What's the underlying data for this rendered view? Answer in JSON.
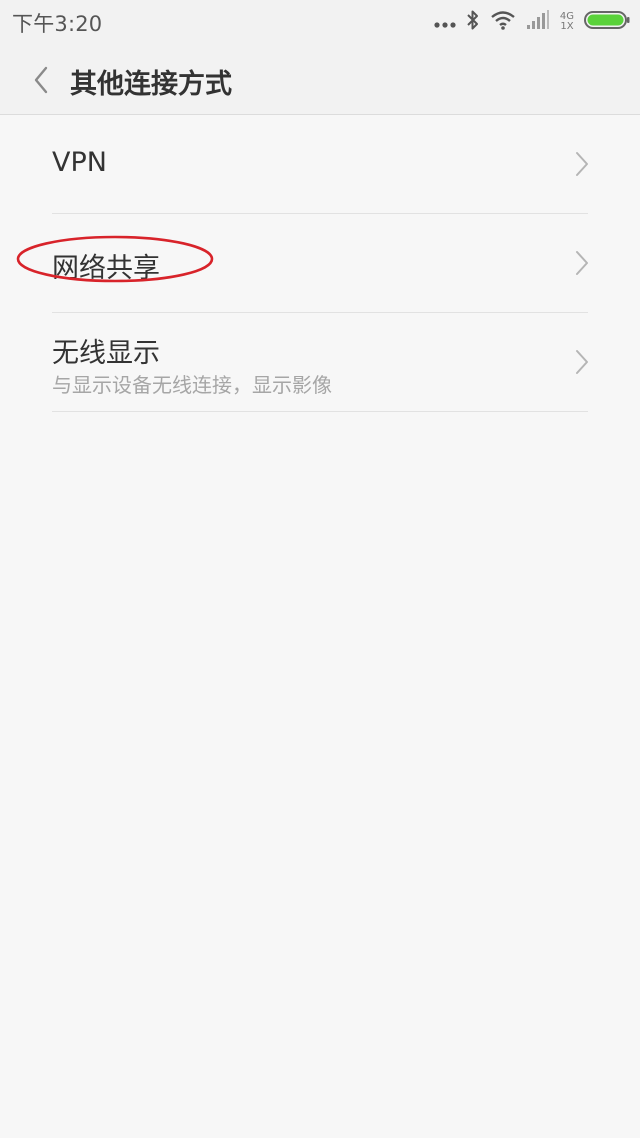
{
  "status_bar": {
    "time": "下午3:20",
    "net_top": "4G",
    "net_bottom": "1X",
    "icons": [
      "more-dots-icon",
      "bluetooth-icon",
      "wifi-icon",
      "signal-icon",
      "battery-icon"
    ],
    "battery_color": "#5ad23a"
  },
  "header": {
    "title": "其他连接方式",
    "back_icon": "chevron-left-icon"
  },
  "list": {
    "items": [
      {
        "title": "VPN",
        "subtitle": ""
      },
      {
        "title": "网络共享",
        "subtitle": "",
        "annotation_color": "#d8232a"
      },
      {
        "title": "无线显示",
        "subtitle": "与显示设备无线连接，显示影像"
      }
    ]
  }
}
